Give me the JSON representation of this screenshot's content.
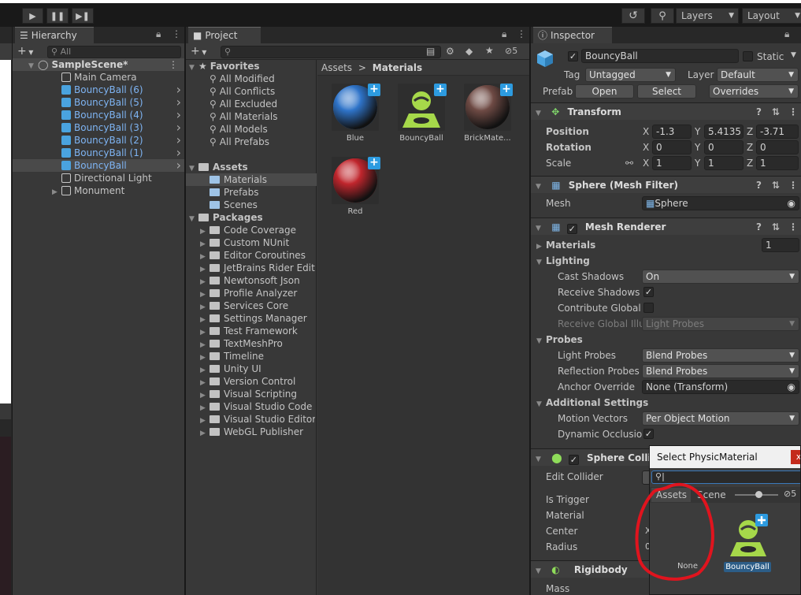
{
  "toolbar": {
    "play_icon": "play-icon",
    "pause_icon": "pause-icon",
    "step_icon": "step-icon",
    "history_icon": "history-icon",
    "search_icon": "search-icon",
    "layers_label": "Layers",
    "layout_label": "Layout"
  },
  "hierarchy": {
    "tab_label": "Hierarchy",
    "add_label": "+",
    "search_placeholder": "All",
    "scene_name": "SampleScene*",
    "items": [
      {
        "label": "Main Camera",
        "blue": false
      },
      {
        "label": "BouncyBall (6)",
        "blue": true
      },
      {
        "label": "BouncyBall (5)",
        "blue": true
      },
      {
        "label": "BouncyBall (4)",
        "blue": true
      },
      {
        "label": "BouncyBall (3)",
        "blue": true
      },
      {
        "label": "BouncyBall (2)",
        "blue": true
      },
      {
        "label": "BouncyBall (1)",
        "blue": true
      },
      {
        "label": "BouncyBall",
        "blue": true
      },
      {
        "label": "Directional Light",
        "blue": false
      },
      {
        "label": "Monument",
        "blue": false
      }
    ]
  },
  "project": {
    "tab_label": "Project",
    "add_label": "+",
    "hidden_count": "5",
    "favorites_label": "Favorites",
    "favorites": [
      "All Modified",
      "All Conflicts",
      "All Excluded",
      "All Materials",
      "All Models",
      "All Prefabs"
    ],
    "assets_label": "Assets",
    "asset_folders": [
      "Materials",
      "Prefabs",
      "Scenes"
    ],
    "packages_label": "Packages",
    "packages": [
      "Code Coverage",
      "Custom NUnit",
      "Editor Coroutines",
      "JetBrains Rider Editor",
      "Newtonsoft Json",
      "Profile Analyzer",
      "Services Core",
      "Settings Manager",
      "Test Framework",
      "TextMeshPro",
      "Timeline",
      "Unity UI",
      "Version Control",
      "Visual Scripting",
      "Visual Studio Code Ed",
      "Visual Studio Editor",
      "WebGL Publisher"
    ],
    "breadcrumb_root": "Assets",
    "breadcrumb_sep": ">",
    "breadcrumb_current": "Materials",
    "grid": [
      {
        "label": "Blue",
        "color": "#2f74c9"
      },
      {
        "label": "BouncyBall",
        "color": "#a6d84a"
      },
      {
        "label": "BrickMate...",
        "color": "#6e4a44"
      },
      {
        "label": "Red",
        "color": "#c0262d"
      }
    ]
  },
  "inspector": {
    "tab_label": "Inspector",
    "object_name": "BouncyBall",
    "static_label": "Static",
    "tag_label": "Tag",
    "tag_value": "Untagged",
    "layer_label": "Layer",
    "layer_value": "Default",
    "prefab_label": "Prefab",
    "open_label": "Open",
    "select_label": "Select",
    "overrides_label": "Overrides",
    "transform": {
      "title": "Transform",
      "position_label": "Position",
      "pos": [
        "-1.3",
        "5.4135",
        "-3.71"
      ],
      "rotation_label": "Rotation",
      "rot": [
        "0",
        "0",
        "0"
      ],
      "scale_label": "Scale",
      "scl": [
        "1",
        "1",
        "1"
      ],
      "x": "X",
      "y": "Y",
      "z": "Z"
    },
    "mesh_filter": {
      "title": "Sphere (Mesh Filter)",
      "mesh_label": "Mesh",
      "mesh_value": "Sphere"
    },
    "mesh_renderer": {
      "title": "Mesh Renderer",
      "materials_label": "Materials",
      "materials_count": "1",
      "lighting_label": "Lighting",
      "cast_shadows_label": "Cast Shadows",
      "cast_shadows_value": "On",
      "receive_shadows_label": "Receive Shadows",
      "contribute_gi_label": "Contribute Global Il",
      "receive_gi_label": "Receive Global Illu",
      "receive_gi_value": "Light Probes",
      "probes_label": "Probes",
      "light_probes_label": "Light Probes",
      "light_probes_value": "Blend Probes",
      "reflection_probes_label": "Reflection Probes",
      "reflection_probes_value": "Blend Probes",
      "anchor_override_label": "Anchor Override",
      "anchor_override_value": "None (Transform)",
      "additional_settings_label": "Additional Settings",
      "motion_vectors_label": "Motion Vectors",
      "motion_vectors_value": "Per Object Motion",
      "dynamic_occlusion_label": "Dynamic Occlusion"
    },
    "sphere_collider": {
      "title": "Sphere Collider",
      "edit_collider_label": "Edit Collider",
      "is_trigger_label": "Is Trigger",
      "material_label": "Material",
      "center_label": "Center",
      "radius_label": "Radius"
    },
    "rigidbody": {
      "title": "Rigidbody",
      "mass_label": "Mass"
    }
  },
  "picker": {
    "title": "Select PhysicMaterial",
    "close_label": "x",
    "tab_assets": "Assets",
    "tab_scene": "Scene",
    "hidden_count": "5",
    "none_label": "None",
    "item_label": "BouncyBall",
    "annotation_color": "#e0141e"
  }
}
